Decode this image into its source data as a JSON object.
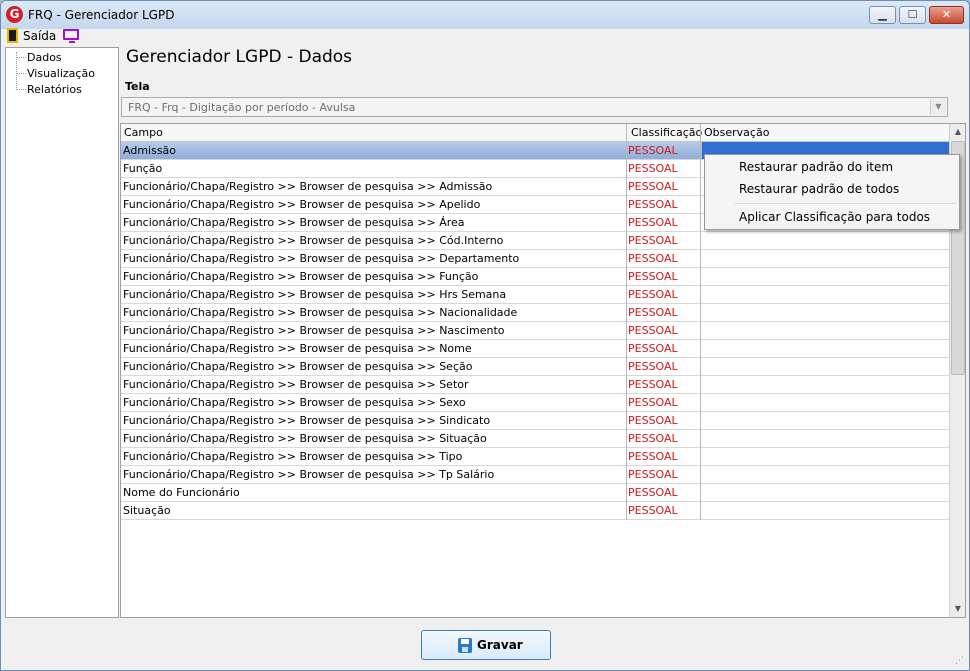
{
  "window": {
    "title": "FRQ - Gerenciador LGPD",
    "app_icon_letter": "G",
    "minimize_symbol": "▁",
    "maximize_symbol": "☐",
    "close_symbol": "✕"
  },
  "menubar": {
    "exit_label": "Saída"
  },
  "sidebar": {
    "items": [
      {
        "label": "Dados"
      },
      {
        "label": "Visualização"
      },
      {
        "label": "Relatórios"
      }
    ]
  },
  "main": {
    "title": "Gerenciador LGPD - Dados",
    "tela_label": "Tela",
    "tela_value": "FRQ - Frq - Digitação por período - Avulsa",
    "dropdown_arrow": "▼"
  },
  "grid": {
    "columns": [
      "Campo",
      "Classificação",
      "Observação"
    ],
    "rows": [
      {
        "campo": "Admissão",
        "classificacao": "PESSOAL",
        "observacao": ""
      },
      {
        "campo": "Função",
        "classificacao": "PESSOAL",
        "observacao": ""
      },
      {
        "campo": "Funcionário/Chapa/Registro >> Browser de pesquisa >> Admissão",
        "classificacao": "PESSOAL",
        "observacao": ""
      },
      {
        "campo": "Funcionário/Chapa/Registro >> Browser de pesquisa >> Apelido",
        "classificacao": "PESSOAL",
        "observacao": ""
      },
      {
        "campo": "Funcionário/Chapa/Registro >> Browser de pesquisa >> Área",
        "classificacao": "PESSOAL",
        "observacao": ""
      },
      {
        "campo": "Funcionário/Chapa/Registro >> Browser de pesquisa >> Cód.Interno",
        "classificacao": "PESSOAL",
        "observacao": ""
      },
      {
        "campo": "Funcionário/Chapa/Registro >> Browser de pesquisa >> Departamento",
        "classificacao": "PESSOAL",
        "observacao": ""
      },
      {
        "campo": "Funcionário/Chapa/Registro >> Browser de pesquisa >> Função",
        "classificacao": "PESSOAL",
        "observacao": ""
      },
      {
        "campo": "Funcionário/Chapa/Registro >> Browser de pesquisa >> Hrs Semana",
        "classificacao": "PESSOAL",
        "observacao": ""
      },
      {
        "campo": "Funcionário/Chapa/Registro >> Browser de pesquisa >> Nacionalidade",
        "classificacao": "PESSOAL",
        "observacao": ""
      },
      {
        "campo": "Funcionário/Chapa/Registro >> Browser de pesquisa >> Nascimento",
        "classificacao": "PESSOAL",
        "observacao": ""
      },
      {
        "campo": "Funcionário/Chapa/Registro >> Browser de pesquisa >> Nome",
        "classificacao": "PESSOAL",
        "observacao": ""
      },
      {
        "campo": "Funcionário/Chapa/Registro >> Browser de pesquisa >> Seção",
        "classificacao": "PESSOAL",
        "observacao": ""
      },
      {
        "campo": "Funcionário/Chapa/Registro >> Browser de pesquisa >> Setor",
        "classificacao": "PESSOAL",
        "observacao": ""
      },
      {
        "campo": "Funcionário/Chapa/Registro >> Browser de pesquisa >> Sexo",
        "classificacao": "PESSOAL",
        "observacao": ""
      },
      {
        "campo": "Funcionário/Chapa/Registro >> Browser de pesquisa >> Sindicato",
        "classificacao": "PESSOAL",
        "observacao": ""
      },
      {
        "campo": "Funcionário/Chapa/Registro >> Browser de pesquisa >> Situação",
        "classificacao": "PESSOAL",
        "observacao": ""
      },
      {
        "campo": "Funcionário/Chapa/Registro >> Browser de pesquisa >> Tipo",
        "classificacao": "PESSOAL",
        "observacao": ""
      },
      {
        "campo": "Funcionário/Chapa/Registro >> Browser de pesquisa >> Tp Salário",
        "classificacao": "PESSOAL",
        "observacao": ""
      },
      {
        "campo": "Nome do Funcionário",
        "classificacao": "PESSOAL",
        "observacao": ""
      },
      {
        "campo": "Situação",
        "classificacao": "PESSOAL",
        "observacao": ""
      }
    ],
    "selected_row": 0,
    "scroll_up": "▲",
    "scroll_down": "▼"
  },
  "context_menu": {
    "items": [
      {
        "label": "Restaurar padrão do item"
      },
      {
        "label": "Restaurar padrão de todos"
      },
      {
        "label": "Aplicar Classificação para todos"
      }
    ]
  },
  "footer": {
    "save_label": "Gravar"
  },
  "colors": {
    "classification_text": "#d01818",
    "selection": "#2f6fd0"
  }
}
